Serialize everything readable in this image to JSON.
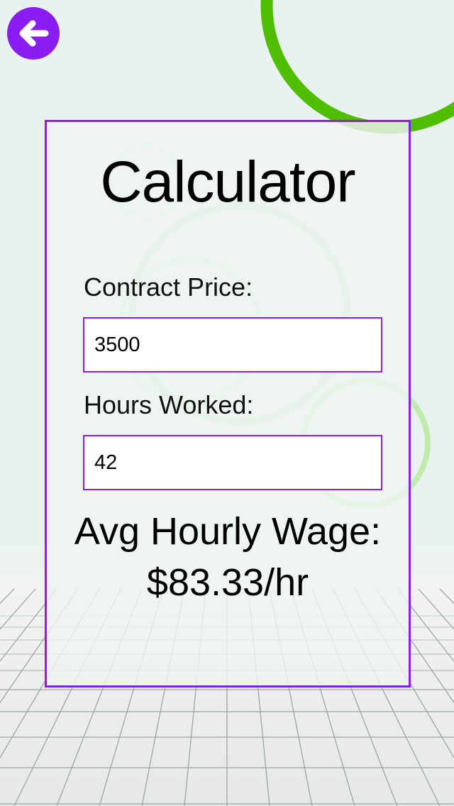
{
  "header": {
    "back_icon": "arrow-left-icon"
  },
  "calculator": {
    "title": "Calculator",
    "contract_price_label": "Contract Price:",
    "contract_price_value": "3500",
    "hours_worked_label": "Hours Worked:",
    "hours_worked_value": "42",
    "result_label": "Avg Hourly Wage:",
    "result_value": "$83.33/hr"
  },
  "colors": {
    "accent": "#8a1ef0",
    "ring": "#4fbe00",
    "background": "#e9f2f0"
  }
}
